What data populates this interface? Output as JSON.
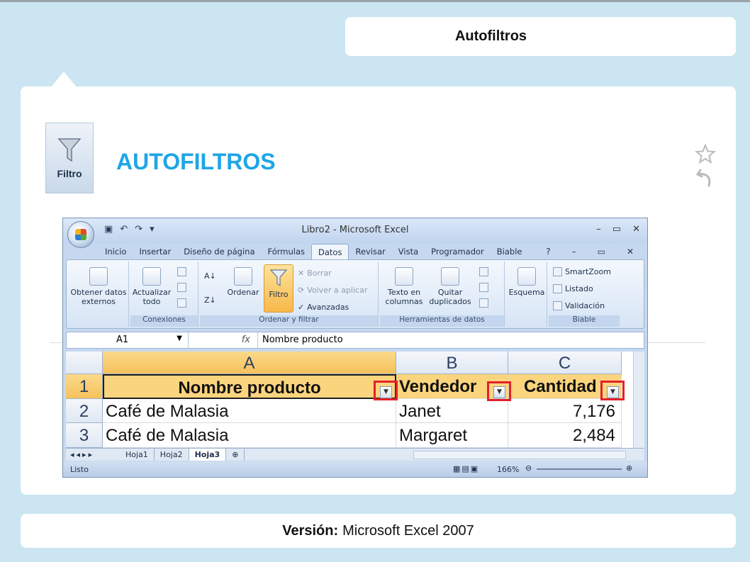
{
  "page": {
    "tab_title": "Autofiltros",
    "icon_label": "Filtro",
    "heading": "AUTOFILTROS",
    "footer": {
      "label": "Versión:",
      "value": "Microsoft Excel 2007"
    }
  },
  "excel": {
    "window_title": "Libro2 - Microsoft Excel",
    "menu": [
      "Inicio",
      "Insertar",
      "Diseño de página",
      "Fórmulas",
      "Datos",
      "Revisar",
      "Vista",
      "Programador",
      "Biable"
    ],
    "active_menu": "Datos",
    "ribbon": {
      "obtener": "Obtener datos externos",
      "actualizar": "Actualizar todo",
      "conexiones": "Conexiones",
      "ordenar": "Ordenar",
      "filtro": "Filtro",
      "borrar": "Borrar",
      "volver": "Volver a aplicar",
      "avanzadas": "Avanzadas",
      "ordenar_filtrar": "Ordenar y filtrar",
      "texto_columnas": "Texto en columnas",
      "quitar_duplicados": "Quitar duplicados",
      "herramientas": "Herramientas de datos",
      "esquema": "Esquema",
      "smartzoom": "SmartZoom",
      "listado": "Listado",
      "validacion": "Validación",
      "biable": "Biable"
    },
    "name_box": "A1",
    "fx": "fx",
    "formula": "Nombre producto",
    "columns": [
      "A",
      "B",
      "C"
    ],
    "rows": [
      "1",
      "2",
      "3"
    ],
    "header_row": [
      "Nombre producto",
      "Vendedor",
      "Cantidad"
    ],
    "data_rows": [
      [
        "Café de Malasia",
        "Janet",
        "7,176"
      ],
      [
        "Café de Malasia",
        "Margaret",
        "2,484"
      ]
    ],
    "sheets": [
      "Hoja1",
      "Hoja2",
      "Hoja3"
    ],
    "active_sheet": "Hoja3",
    "status": "Listo",
    "zoom": "166%"
  },
  "colors": {
    "accent": "#1ea6e6",
    "highlight": "#e3202a"
  }
}
